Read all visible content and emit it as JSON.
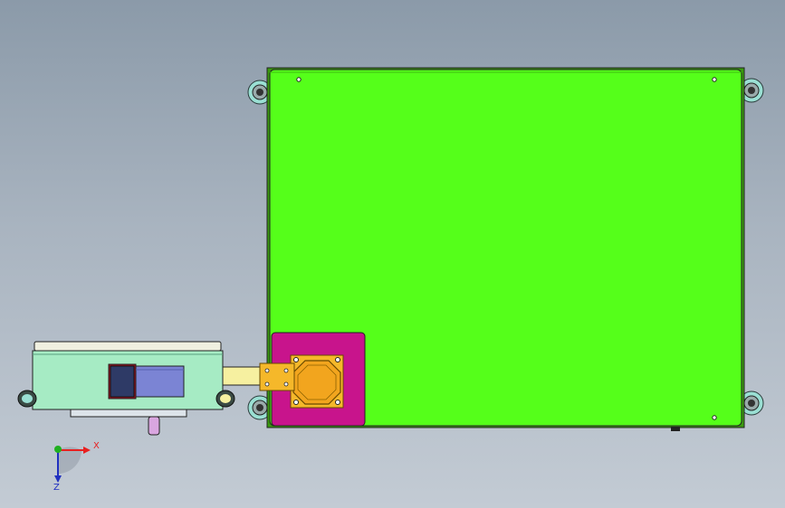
{
  "viewport": {
    "background_top": "#8b9aa9",
    "background_bottom": "#c3cbd4"
  },
  "colors": {
    "panel": "#55ff1a",
    "mount_plate": "#c8148c",
    "flange": "#f5b82a",
    "arm": "#f6f0a0",
    "base_body": "#a6ebc4",
    "cylinder_dark": "#2e3a66",
    "cylinder_light": "#7b84d4",
    "wheel_outer": "#9adfd3",
    "axis_x": "#e82020",
    "axis_y": "#20b020",
    "axis_z": "#2030c0"
  },
  "triad": {
    "x_label": "X",
    "z_label": "Z"
  }
}
